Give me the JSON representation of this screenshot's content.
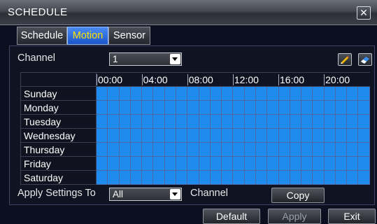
{
  "window": {
    "title": "SCHEDULE",
    "close_label": "✕"
  },
  "tabs": [
    {
      "label": "Schedule",
      "active": false
    },
    {
      "label": "Motion",
      "active": true
    },
    {
      "label": "Sensor",
      "active": false
    }
  ],
  "channel": {
    "label": "Channel",
    "value": "1"
  },
  "icons": {
    "edit": "pencil-icon",
    "erase": "eraser-icon"
  },
  "grid": {
    "hour_labels": [
      "00:00",
      "04:00",
      "08:00",
      "12:00",
      "16:00",
      "20:00"
    ],
    "days": [
      "Sunday",
      "Monday",
      "Tuesday",
      "Wednesday",
      "Thursday",
      "Friday",
      "Saturday"
    ],
    "cells_per_day": 24,
    "fill_color": "#1f8bee",
    "all_selected": true
  },
  "apply_settings": {
    "label": "Apply Settings To",
    "value": "All",
    "suffix": "Channel",
    "copy_label": "Copy"
  },
  "footer": {
    "default_label": "Default",
    "apply_label": "Apply",
    "exit_label": "Exit"
  }
}
